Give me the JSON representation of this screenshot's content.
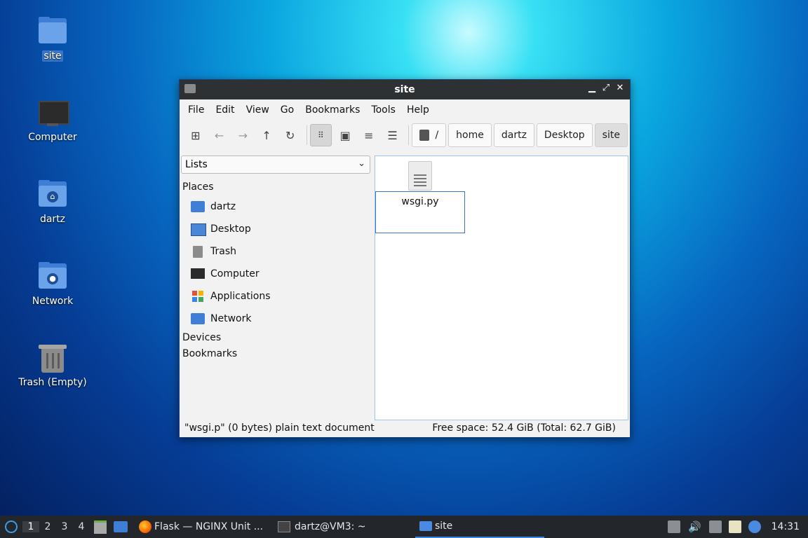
{
  "desktop": {
    "icons": [
      {
        "label": "site"
      },
      {
        "label": "Computer"
      },
      {
        "label": "dartz"
      },
      {
        "label": "Network"
      },
      {
        "label": "Trash (Empty)"
      }
    ]
  },
  "window": {
    "title": "site",
    "controls": {
      "minimize": "▁",
      "maximize": "⤢",
      "close": "✕"
    },
    "menu": [
      "File",
      "Edit",
      "View",
      "Go",
      "Bookmarks",
      "Tools",
      "Help"
    ],
    "path": {
      "root": "/",
      "crumbs": [
        "home",
        "dartz",
        "Desktop",
        "site"
      ]
    },
    "sidebar": {
      "view_select": "Lists",
      "sections": {
        "places": "Places",
        "devices": "Devices",
        "bookmarks": "Bookmarks"
      },
      "places": [
        "dartz",
        "Desktop",
        "Trash",
        "Computer",
        "Applications",
        "Network"
      ]
    },
    "files": [
      {
        "name": "wsgi.py"
      }
    ],
    "status": {
      "left": "\"wsgi.p\" (0 bytes) plain text document",
      "right": "Free space: 52.4 GiB (Total: 62.7 GiB)"
    }
  },
  "taskbar": {
    "workspaces": [
      "1",
      "2",
      "3",
      "4"
    ],
    "tasks": [
      "Flask — NGINX Unit ...",
      "dartz@VM3: ~",
      "site"
    ],
    "clock": "14:31"
  }
}
